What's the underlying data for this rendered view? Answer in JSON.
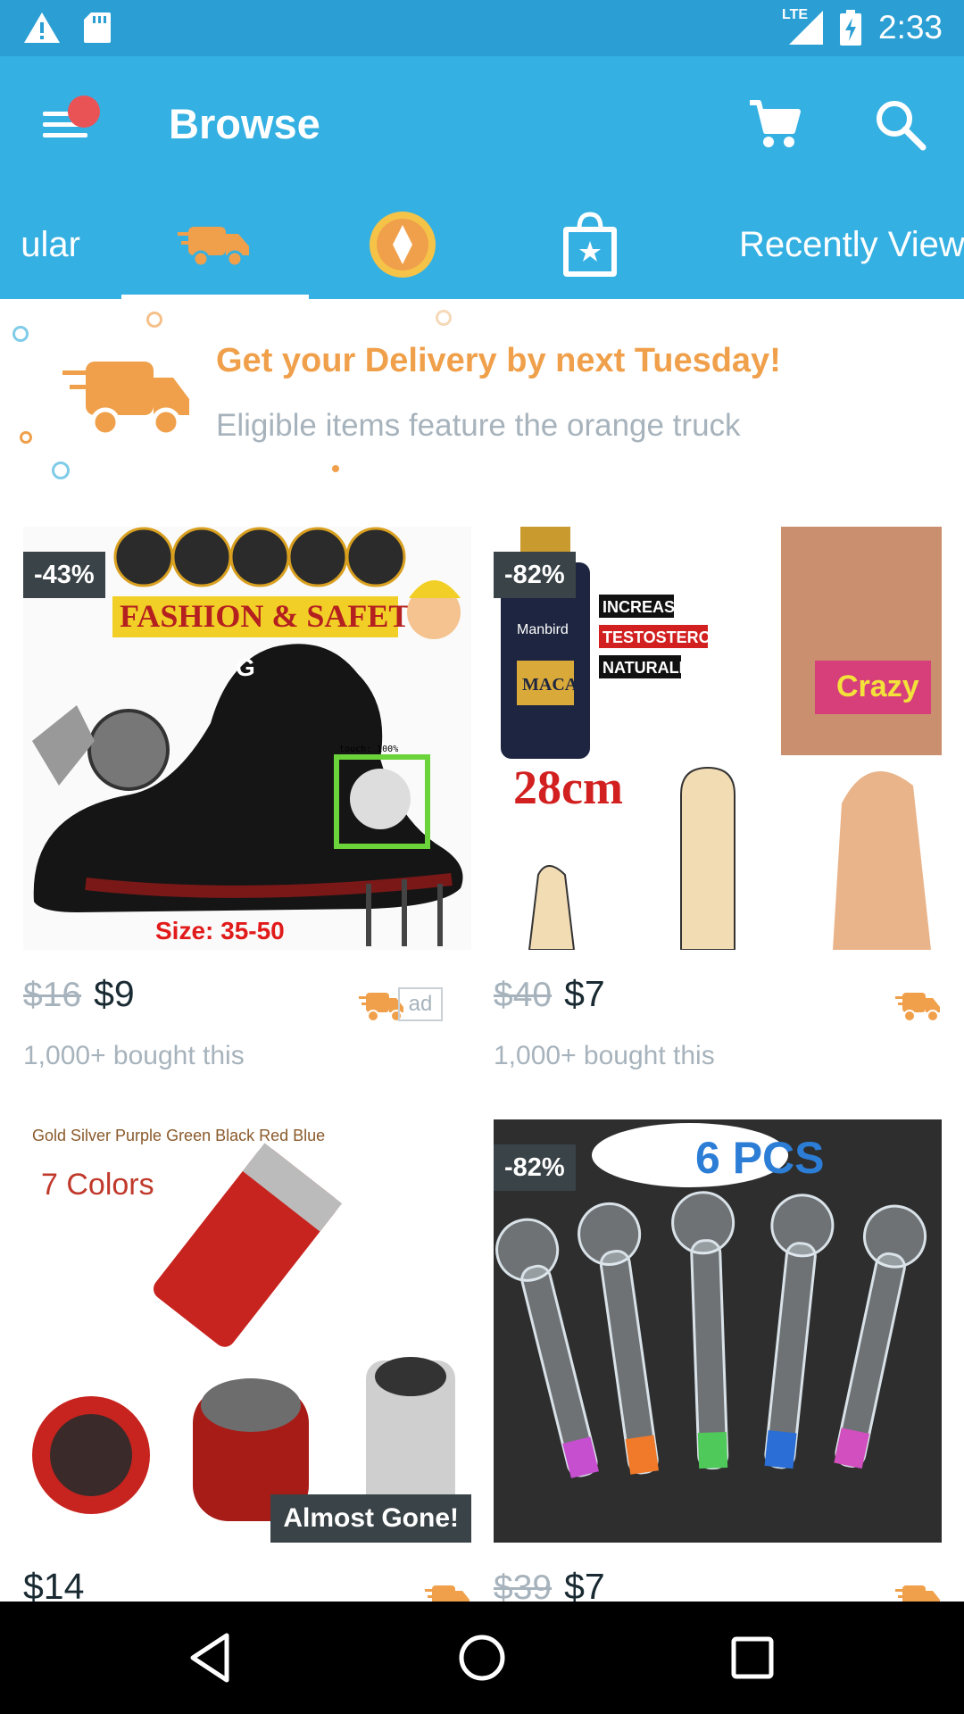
{
  "status_bar": {
    "time": "2:33",
    "network": "LTE",
    "icons": [
      "warning-icon",
      "sd-card-icon",
      "signal-icon",
      "battery-charging-icon"
    ]
  },
  "app_bar": {
    "title": "Browse",
    "icons": [
      "menu-icon",
      "notification-dot",
      "cart-icon",
      "search-icon"
    ],
    "colors": {
      "primary": "#35b0e2",
      "accent": "#f0a04b",
      "badge": "#ea5356"
    }
  },
  "tabs": [
    {
      "label": "ular",
      "type": "text"
    },
    {
      "icon": "delivery-truck-icon",
      "type": "icon",
      "selected": true
    },
    {
      "icon": "gold-coin-icon",
      "type": "icon"
    },
    {
      "icon": "shopping-bag-star-icon",
      "type": "icon"
    },
    {
      "label": "Recently View",
      "type": "text"
    }
  ],
  "banner": {
    "title": "Get your Delivery by next Tuesday!",
    "subtitle": "Eligible items feature the orange truck"
  },
  "products": [
    {
      "discount": "-43%",
      "old_price": "$16",
      "new_price": "$9",
      "bought": "1,000+ bought this",
      "ad": "ad",
      "image_text": {
        "headline": "FASHION & SAFETY",
        "size": "Size: 35-50",
        "touch": "touch: 100%"
      }
    },
    {
      "discount": "-82%",
      "old_price": "$40",
      "new_price": "$7",
      "bought": "1,000+ bought this",
      "image_text": {
        "line1": "INCREASE",
        "line2": "TESTOSTERONE",
        "line3": "NATURALLY",
        "big": "28cm",
        "brand": "Manbird",
        "product": "MACA",
        "tag": "Crazy"
      }
    },
    {
      "new_price": "$14",
      "badge": "Almost Gone!",
      "image_text": {
        "colors_line": "Gold Silver Purple Green Black Red Blue",
        "headline": "7 Colors"
      }
    },
    {
      "discount": "-82%",
      "old_price": "$39",
      "new_price": "$7",
      "image_text": {
        "headline": "6 PCS"
      }
    }
  ],
  "nav_bar": {
    "icons": [
      "back-icon",
      "home-icon",
      "recents-icon"
    ]
  }
}
